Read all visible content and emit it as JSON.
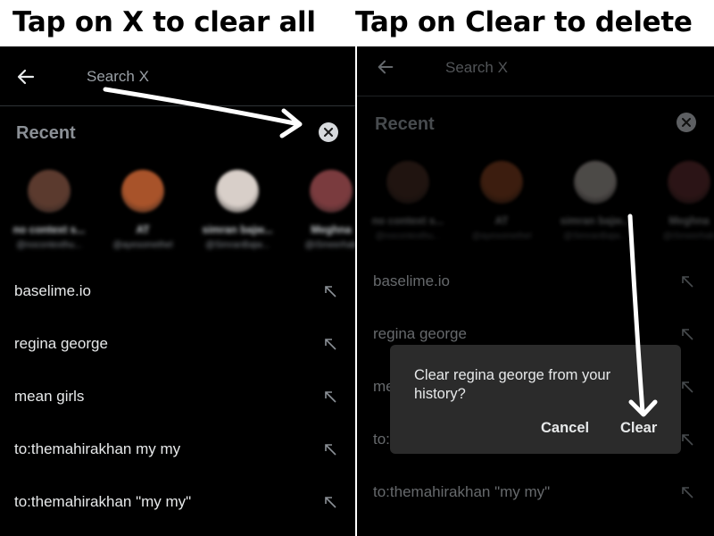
{
  "captions": {
    "left": "Tap on X to clear all",
    "right": "Tap on Clear to delete"
  },
  "left_panel": {
    "search_placeholder": "Search X",
    "recent_label": "Recent",
    "avatars": [
      {
        "name": "no context s...",
        "handle": "@nocontexthu...",
        "color": "#5b3a2e"
      },
      {
        "name": "AT",
        "handle": "@ayesomethel",
        "color": "#a8532a"
      },
      {
        "name": "simran bajw...",
        "handle": "@SimranBajw...",
        "color": "#d8cfc9"
      },
      {
        "name": "Meghna",
        "handle": "@iSmeerhab",
        "color": "#7a3b3e"
      }
    ],
    "items": [
      {
        "label": "baselime.io"
      },
      {
        "label": "regina george"
      },
      {
        "label": "mean girls"
      },
      {
        "label": "to:themahirakhan my my"
      },
      {
        "label": "to:themahirakhan \"my my\""
      }
    ]
  },
  "right_panel": {
    "search_placeholder": "Search X",
    "recent_label": "Recent",
    "avatars": [
      {
        "name": "no context s...",
        "handle": "@nocontexthu...",
        "color": "#5b3a2e"
      },
      {
        "name": "AT",
        "handle": "@ayesomethel",
        "color": "#a8532a"
      },
      {
        "name": "simran bajw...",
        "handle": "@SimranBajw...",
        "color": "#d8cfc9"
      },
      {
        "name": "Meghna",
        "handle": "@iSmeerhab",
        "color": "#7a3b3e"
      }
    ],
    "items": [
      {
        "label": "baselime.io"
      },
      {
        "label": "regina george"
      },
      {
        "label": "me"
      },
      {
        "label": "to:"
      },
      {
        "label": "to:themahirakhan \"my my\""
      }
    ],
    "dialog": {
      "message": "Clear regina george from your history?",
      "cancel_label": "Cancel",
      "clear_label": "Clear"
    }
  },
  "icons": {
    "back": "arrow-left-icon",
    "clear_all": "close-circle-icon",
    "fill_query": "arrow-up-left-icon"
  },
  "colors": {
    "background": "#000000",
    "text": "#e7e9ea",
    "muted": "#8b9096",
    "dialog": "#2b2b2b",
    "annotation": "#ffffff"
  }
}
